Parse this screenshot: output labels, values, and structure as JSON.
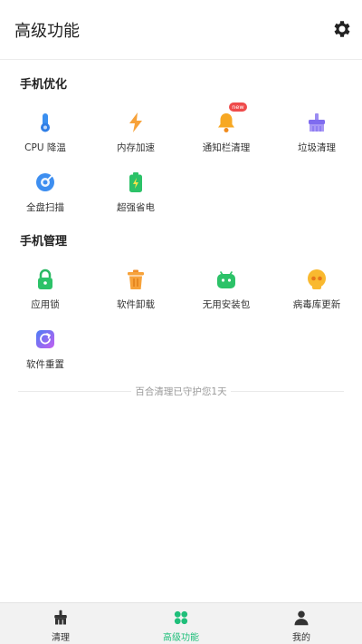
{
  "header": {
    "title": "高级功能",
    "settings_icon": "gear-icon"
  },
  "sections": [
    {
      "title": "手机优化"
    },
    {
      "title": "手机管理"
    }
  ],
  "optimize_items": [
    {
      "label": "CPU 降温",
      "icon": "thermometer-icon"
    },
    {
      "label": "内存加速",
      "icon": "lightning-icon"
    },
    {
      "label": "通知栏清理",
      "icon": "bell-icon",
      "badge": "new"
    },
    {
      "label": "垃圾清理",
      "icon": "broom-icon"
    },
    {
      "label": "全盘扫描",
      "icon": "disk-scan-icon"
    },
    {
      "label": "超强省电",
      "icon": "battery-icon"
    }
  ],
  "manage_items": [
    {
      "label": "应用锁",
      "icon": "lock-icon"
    },
    {
      "label": "软件卸载",
      "icon": "trash-icon"
    },
    {
      "label": "无用安装包",
      "icon": "android-icon"
    },
    {
      "label": "病毒库更新",
      "icon": "skull-icon"
    },
    {
      "label": "软件重置",
      "icon": "reset-icon"
    }
  ],
  "footer_note": "百合清理已守护您1天",
  "tabbar": {
    "tabs": [
      {
        "label": "清理",
        "icon": "brush-icon",
        "active": false
      },
      {
        "label": "高级功能",
        "icon": "grid-icon",
        "active": true
      },
      {
        "label": "我的",
        "icon": "person-icon",
        "active": false
      }
    ]
  },
  "colors": {
    "accent": "#1fbf7a",
    "badge": "#ef4b4b"
  }
}
